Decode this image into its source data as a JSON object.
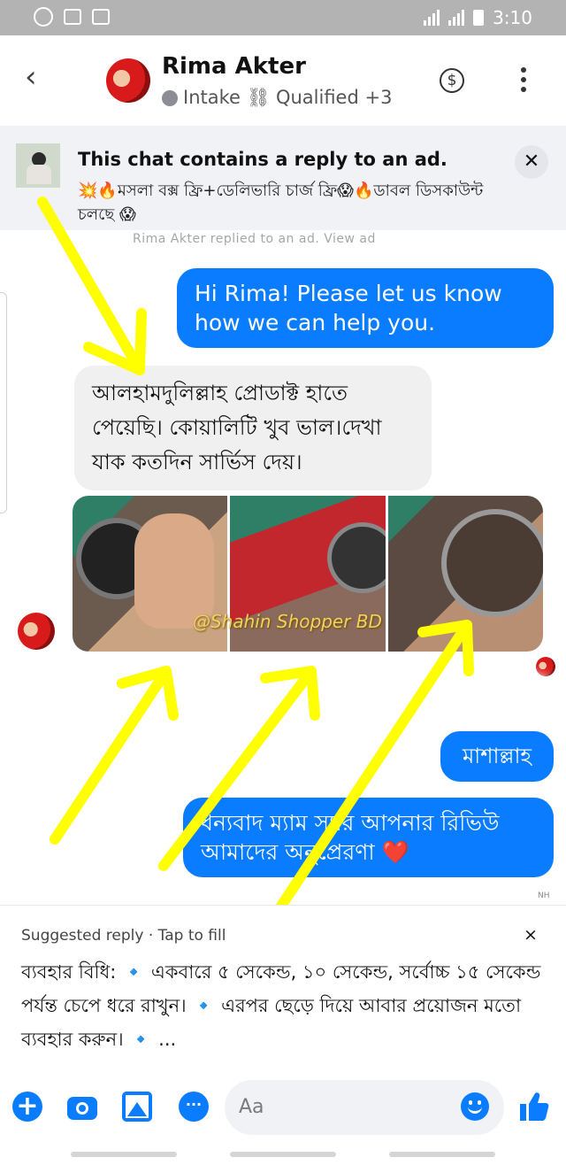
{
  "status_bar": {
    "time": "3:10"
  },
  "header": {
    "back_icon": "chevron-left-icon",
    "contact_name": "Rima Akter",
    "labels": "Intake ⛓ Qualified +3",
    "dollar_icon": "dollar-circle-icon",
    "more_icon": "vertical-ellipsis-icon"
  },
  "ad_banner": {
    "title": "This chat contains a reply to an ad.",
    "text": "💥🔥মসলা বক্স ফ্রি+ডেলিভারি চার্জ ফ্রি😱🔥ডাবল ডিসকাউন্ট চলছে 😱",
    "close_label": "✕",
    "replied_line": "Rima Akter replied to an ad. View ad"
  },
  "messages": [
    {
      "direction": "outgoing",
      "text": "Hi Rima! Please let us know how we can help you."
    },
    {
      "direction": "incoming",
      "text": "আলহামদুলিল্লাহ প্রোডাক্ট হাতে পেয়েছি। কোয়ালিটি খুব ভাল।দেখা যাক কতদিন সার্ভিস দেয়।"
    },
    {
      "direction": "incoming",
      "type": "photos",
      "count": 3,
      "watermark": "@Shahin Shopper BD"
    },
    {
      "direction": "outgoing",
      "text": "মাশাল্লাহ"
    },
    {
      "direction": "outgoing",
      "text": "ধন্যবাদ ম্যাম স্যার আপনার রিভিউ আমাদের অনুপ্রেরণা ❤️"
    }
  ],
  "seen_text": "NH",
  "suggested_reply": {
    "label": "Suggested reply · Tap to fill",
    "close_label": "×",
    "text": "ব্যবহার বিধি: 🔹 একবারে ৫ সেকেন্ড, ১০ সেকেন্ড, সর্বোচ্চ ১৫ সেকেন্ড পর্যন্ত চেপে ধরে রাখুন। 🔹 এরপর ছেড়ে দিয়ে আবার প্রয়োজন মতো ব্যবহার করুন। 🔹 ..."
  },
  "composer": {
    "placeholder": "Aa",
    "icons": [
      "plus-icon",
      "camera-icon",
      "image-icon",
      "message-icon",
      "emoji-icon",
      "thumbs-up-icon"
    ]
  },
  "colors": {
    "accent": "#0a7cff",
    "annotation_arrow": "#ffff00",
    "incoming_bubble": "#f0f0f0"
  }
}
